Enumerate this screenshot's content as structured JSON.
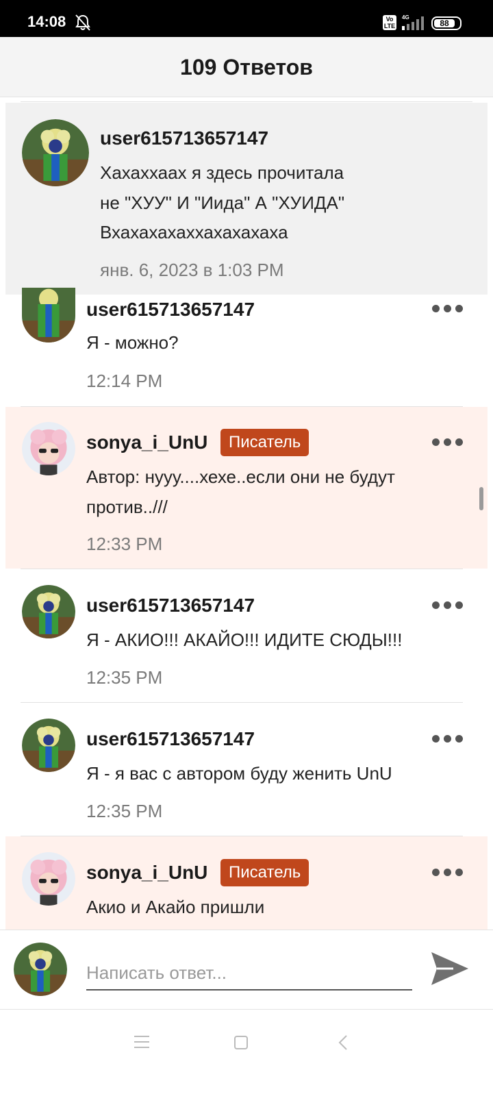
{
  "status_bar": {
    "time": "14:08",
    "network": "4G",
    "volte": "Vo LTE",
    "battery": "88",
    "icons": [
      "bell-muted-icon",
      "volte-icon",
      "signal-icon",
      "battery-icon"
    ]
  },
  "header": {
    "title": "109 Ответов"
  },
  "original_comment": {
    "username": "user615713657147",
    "text_lines": [
      "Хахаххаах я здесь прочитала",
      "не \"ХУУ\" И \"Иида\" А \"ХУИДА\"",
      "Вхахахахаххахахахаха"
    ],
    "timestamp": "янв. 6, 2023 в 1:03 PM"
  },
  "replies": [
    {
      "username": "user615713657147",
      "badge": "",
      "text_lines": [
        "Я - можно?"
      ],
      "timestamp": "12:14 PM"
    },
    {
      "username": "sonya_i_UnU",
      "badge": "Писатель",
      "text_lines": [
        "Автор: нууу....хехе..если они не будут",
        "против..///"
      ],
      "timestamp": "12:33 PM"
    },
    {
      "username": "user615713657147",
      "badge": "",
      "text_lines": [
        "Я - АКИО!!! АКАЙО!!! ИДИТЕ СЮДЫ!!!"
      ],
      "timestamp": "12:35 PM"
    },
    {
      "username": "user615713657147",
      "badge": "",
      "text_lines": [
        "Я - я вас с автором буду женить UnU"
      ],
      "timestamp": "12:35 PM"
    },
    {
      "username": "sonya_i_UnU",
      "badge": "Писатель",
      "text_lines": [
        "Акио и Акайо пришли"
      ],
      "timestamp": ""
    }
  ],
  "composer": {
    "placeholder": "Написать ответ..."
  },
  "colors": {
    "author_background": "#fff1ec",
    "badge": "#c0471c",
    "original_background": "#f1f1f1"
  }
}
